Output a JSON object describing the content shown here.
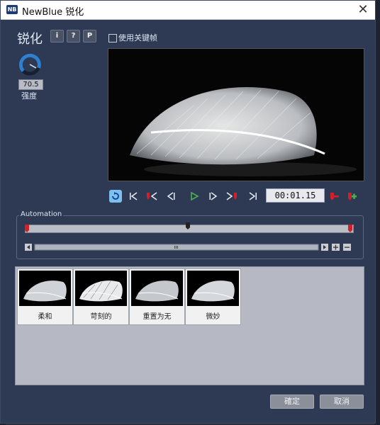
{
  "window": {
    "title": "NewBlue 锐化",
    "logo_text": "NB",
    "close_glyph": "✕"
  },
  "effect": {
    "name": "锐化",
    "info_btn": "i",
    "help_btn": "?",
    "preset_btn": "P"
  },
  "keyframe": {
    "label": "使用关键帧",
    "checked": false
  },
  "strength": {
    "value": "70.5",
    "label": "强度",
    "level": 0.705
  },
  "transport": {
    "timecode": "00:01.15"
  },
  "automation": {
    "label": "Automation"
  },
  "presets": [
    {
      "label": "柔和"
    },
    {
      "label": "苛刻的"
    },
    {
      "label": "重置为无"
    },
    {
      "label": "微妙"
    }
  ],
  "buttons": {
    "ok": "確定",
    "cancel": "取消"
  },
  "colors": {
    "window_bg": "#2e3a54",
    "accent_blue": "#2f7fd1",
    "play_green": "#4caf50",
    "marker_red": "#d0202a"
  }
}
